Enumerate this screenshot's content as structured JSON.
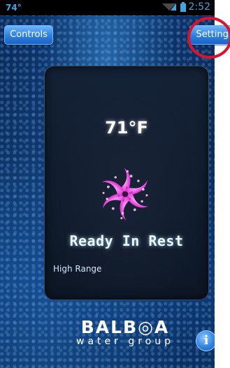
{
  "status_bar": {
    "temperature": "74°",
    "time": "2:52"
  },
  "top_bar": {
    "controls_label": "Controls",
    "settings_label": "Settings"
  },
  "panel": {
    "temperature": "71°F",
    "status": "Ready In Rest",
    "range": "High Range"
  },
  "logo": {
    "brand": "BALB◎A",
    "tagline": "water group"
  },
  "info_button": {
    "glyph": "i"
  },
  "colors": {
    "accent": "#2e7fe0",
    "highlight_ring": "#e0102a",
    "background": "#0b2f63",
    "status_text": "#3ea7e6"
  },
  "icons": [
    "signal-icon",
    "battery-icon",
    "spa-pump-icon",
    "info-icon"
  ]
}
